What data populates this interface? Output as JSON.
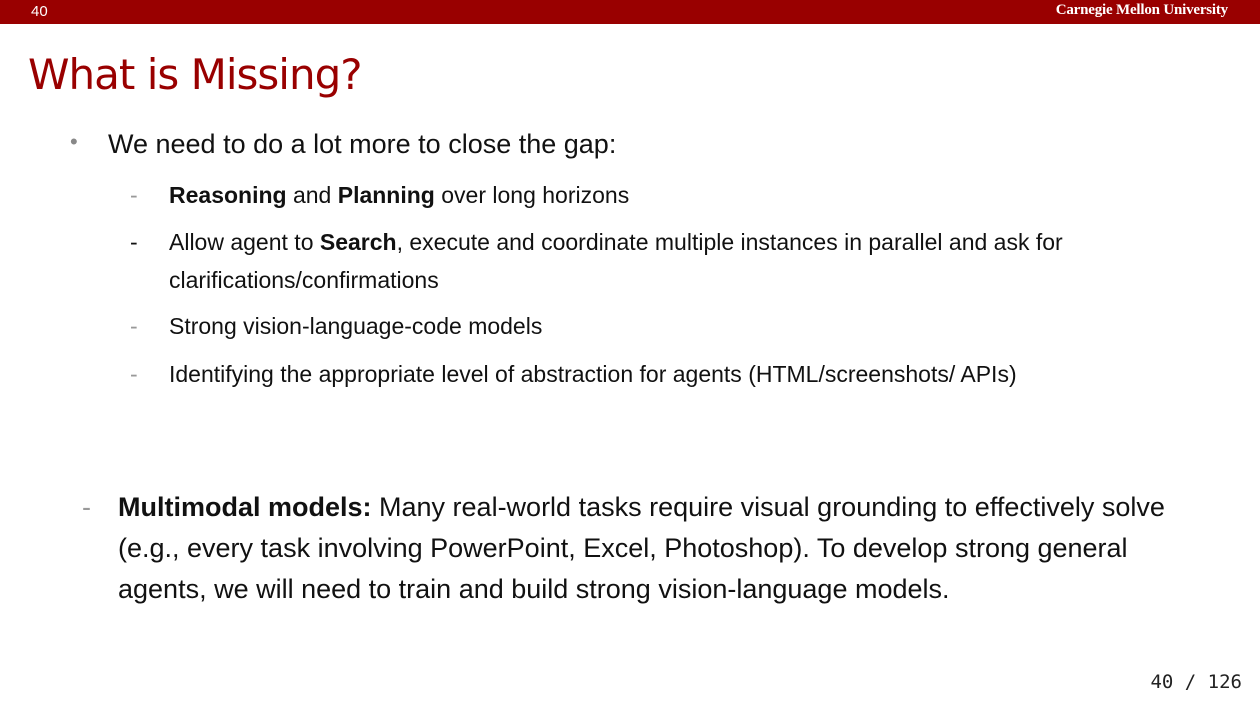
{
  "header": {
    "slide_number": "40",
    "university": "Carnegie Mellon University",
    "accent_color": "#990000"
  },
  "title": "What is Missing?",
  "main_bullet": "We need to do a lot more to close the gap:",
  "sub_bullets": [
    {
      "bold1": "Reasoning",
      "mid": " and ",
      "bold2": "Planning",
      "rest": " over long horizons"
    },
    {
      "pre": "Allow agent to ",
      "bold": "Search",
      "rest": ", execute and coordinate multiple instances in parallel and ask for clarifications/confirmations"
    },
    {
      "text": "Strong vision-language-code models"
    },
    {
      "text": "Identifying the appropriate level of abstraction for agents (HTML/screenshots/ APIs)"
    }
  ],
  "multimodal": {
    "label": "Multimodal models:",
    "text": " Many real-world tasks require visual grounding to effectively solve (e.g., every task involving PowerPoint, Excel, Photoshop). To develop strong general agents, we will need to train and build strong vision-language models."
  },
  "footer": {
    "page_indicator": "40 / 126"
  }
}
